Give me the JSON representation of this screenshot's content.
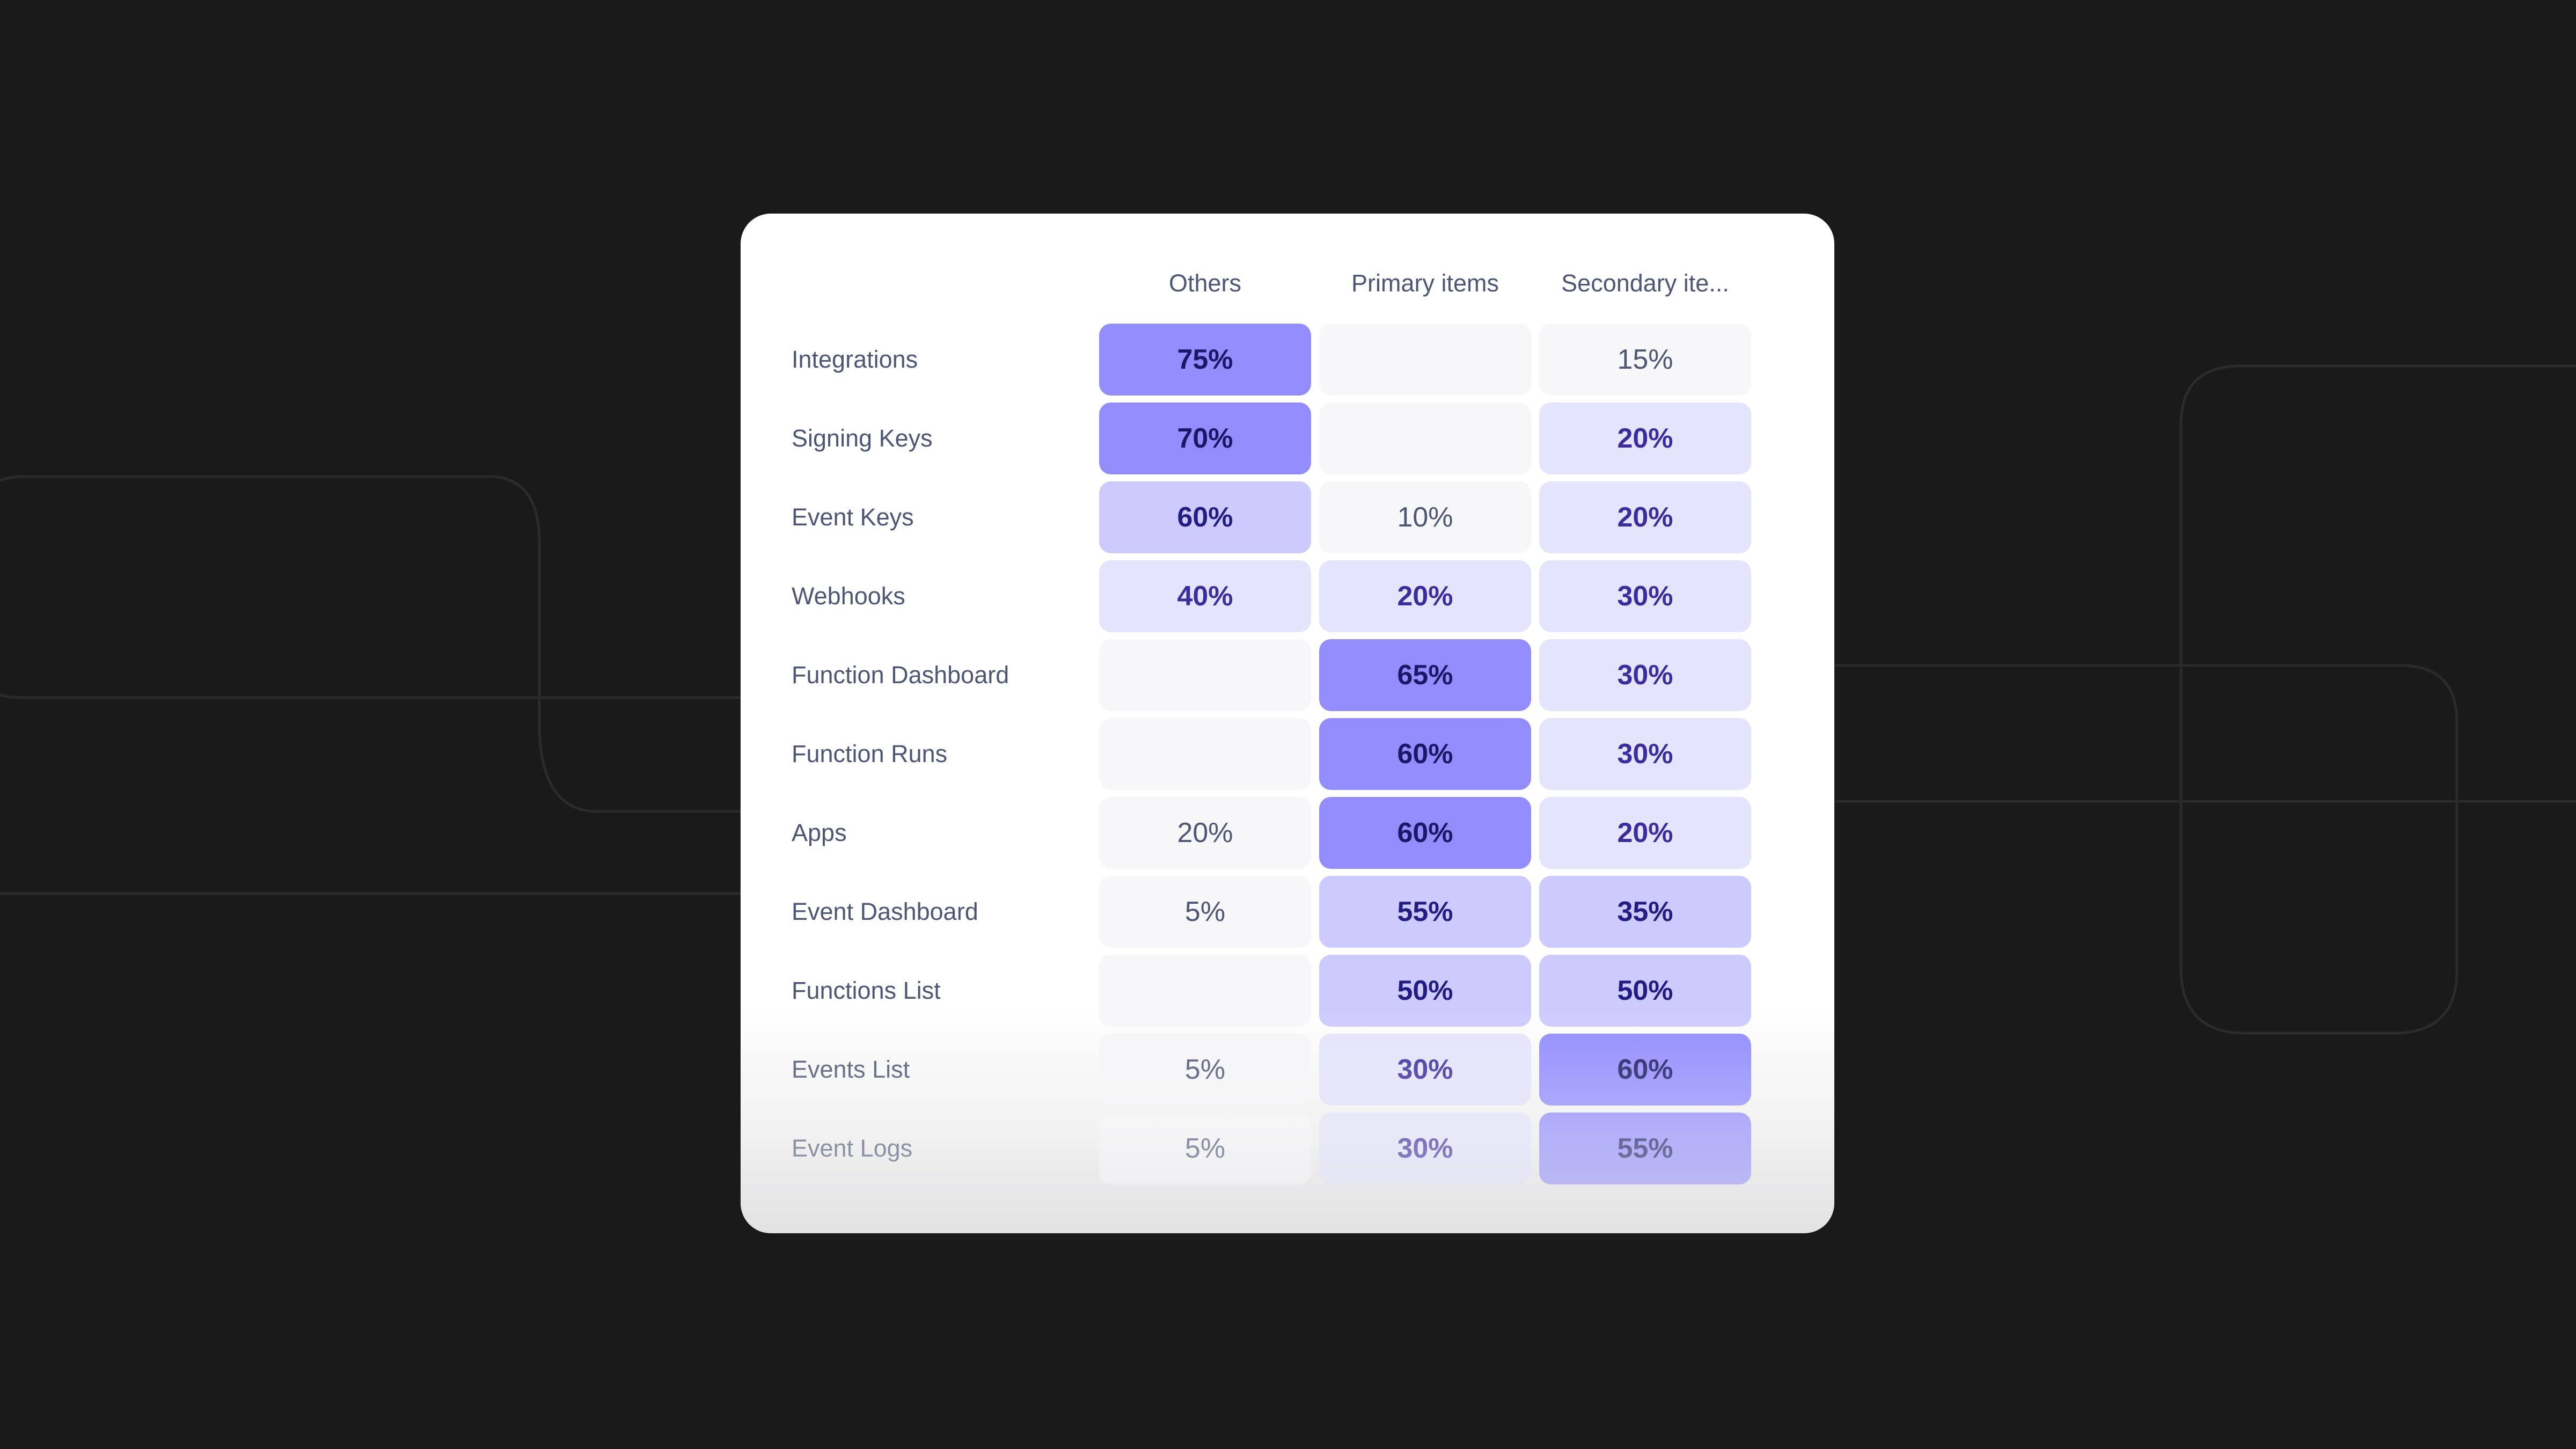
{
  "chart_data": {
    "type": "heatmap",
    "title": "",
    "columns": [
      "Others",
      "Primary items",
      "Secondary ite..."
    ],
    "rows": [
      {
        "label": "Integrations",
        "values": [
          "75%",
          "",
          "15%"
        ]
      },
      {
        "label": "Signing Keys",
        "values": [
          "70%",
          "",
          "20%"
        ]
      },
      {
        "label": "Event Keys",
        "values": [
          "60%",
          "10%",
          "20%"
        ]
      },
      {
        "label": "Webhooks",
        "values": [
          "40%",
          "20%",
          "30%"
        ]
      },
      {
        "label": "Function Dashboard",
        "values": [
          "",
          "65%",
          "30%"
        ]
      },
      {
        "label": "Function Runs",
        "values": [
          "",
          "60%",
          "30%"
        ]
      },
      {
        "label": "Apps",
        "values": [
          "20%",
          "60%",
          "20%"
        ]
      },
      {
        "label": "Event Dashboard",
        "values": [
          "5%",
          "55%",
          "35%"
        ]
      },
      {
        "label": "Functions List",
        "values": [
          "",
          "50%",
          "50%"
        ]
      },
      {
        "label": "Events List",
        "values": [
          "5%",
          "30%",
          "60%"
        ]
      },
      {
        "label": "Event Logs",
        "values": [
          "5%",
          "30%",
          "55%"
        ]
      }
    ],
    "levels": [
      [
        "3",
        "0",
        "0"
      ],
      [
        "3",
        "0",
        "1"
      ],
      [
        "2",
        "0",
        "1"
      ],
      [
        "1",
        "1",
        "1"
      ],
      [
        "0",
        "3",
        "1"
      ],
      [
        "0",
        "3",
        "1"
      ],
      [
        "0",
        "3",
        "1"
      ],
      [
        "0",
        "2",
        "2"
      ],
      [
        "0",
        "2",
        "2"
      ],
      [
        "0",
        "1",
        "3"
      ],
      [
        "0",
        "1",
        "3"
      ]
    ],
    "color_scale": {
      "empty": "#f7f7f9",
      "low": "#e5e4fd",
      "mid": "#cdcafe",
      "high": "#928cfd"
    }
  },
  "theme": {
    "background": "#1a1a1a",
    "card_background": "#ffffff",
    "label_color": "#4d5674"
  }
}
